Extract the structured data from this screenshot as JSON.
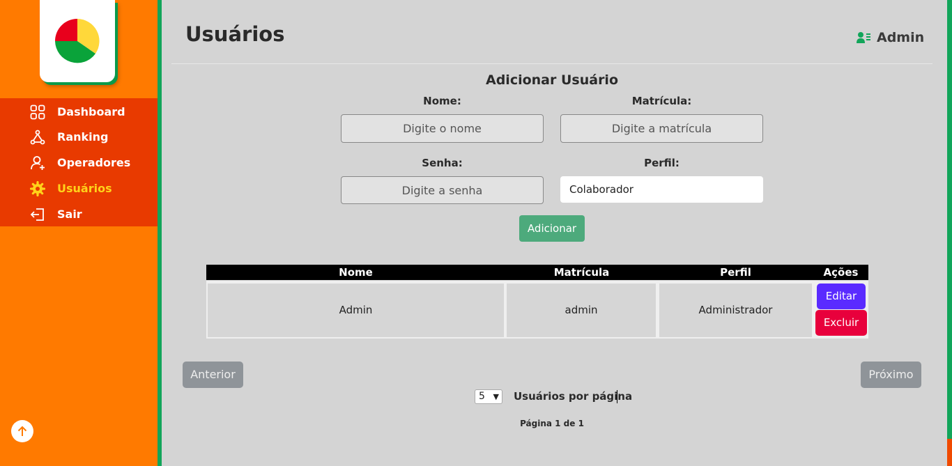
{
  "sidebar": {
    "items": [
      {
        "label": "Dashboard",
        "icon": "grid-icon"
      },
      {
        "label": "Ranking",
        "icon": "hierarchy-icon"
      },
      {
        "label": "Operadores",
        "icon": "user-plus-icon"
      },
      {
        "label": "Usuários",
        "icon": "gear-icon",
        "active": true
      },
      {
        "label": "Sair",
        "icon": "logout-icon"
      }
    ],
    "logo_colors": [
      "#e8001c",
      "#ffd83a",
      "#0aa33a"
    ]
  },
  "header": {
    "title": "Usuários",
    "user_name": "Admin",
    "user_icon": "user-list-icon"
  },
  "form": {
    "title": "Adicionar Usuário",
    "name_label": "Nome:",
    "name_placeholder": "Digite o nome",
    "matricula_label": "Matrícula:",
    "matricula_placeholder": "Digite a matrícula",
    "password_label": "Senha:",
    "password_placeholder": "Digite a senha",
    "profile_label": "Perfil:",
    "profile_value": "Colaborador",
    "submit_label": "Adicionar"
  },
  "table": {
    "headers": [
      "Nome",
      "Matrícula",
      "Perfil",
      "Ações"
    ],
    "rows": [
      {
        "nome": "Admin",
        "matricula": "admin",
        "perfil": "Administrador",
        "edit_label": "Editar",
        "delete_label": "Excluir"
      }
    ]
  },
  "pagination": {
    "prev_label": "Anterior",
    "next_label": "Próximo",
    "per_page_value": "5",
    "per_page_label": "Usuários por página",
    "page_info": "Página 1 de 1"
  },
  "colors": {
    "sidebar": "#ff7a00",
    "nav_bg": "#e83a00",
    "active": "#ffd21a",
    "accent_green": "#12a55a",
    "add_button": "#4daa7c",
    "edit_button": "#5a2bff",
    "delete_button": "#e8003c"
  }
}
